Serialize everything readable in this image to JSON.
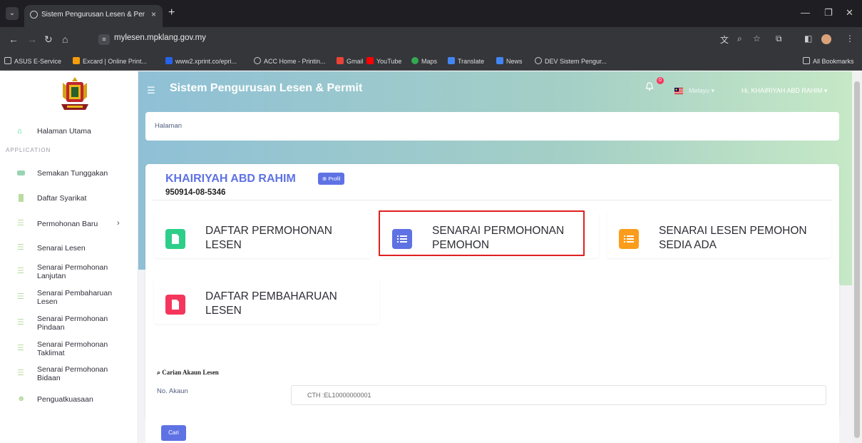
{
  "browser": {
    "tab_title": "Sistem Pengurusan Lesen & Per",
    "url": "mylesen.mpklang.gov.my",
    "bookmarks": [
      {
        "label": "ASUS E-Service",
        "color": "#9ca3af"
      },
      {
        "label": "Excard | Online Print...",
        "color": "#f59e0b"
      },
      {
        "label": "www2.xprint.co/epri...",
        "color": "#2563eb"
      },
      {
        "label": "ACC Home - Printin...",
        "color": "#9ca3af"
      },
      {
        "label": "Gmail",
        "color": "#ea4335"
      },
      {
        "label": "YouTube",
        "color": "#ff0000"
      },
      {
        "label": "Maps",
        "color": "#34a853"
      },
      {
        "label": "Translate",
        "color": "#4285f4"
      },
      {
        "label": "News",
        "color": "#4285f4"
      },
      {
        "label": "DEV Sistem Pengur...",
        "color": "#9ca3af"
      }
    ],
    "all_bookmarks": "All Bookmarks"
  },
  "header": {
    "title": "Sistem Pengurusan Lesen & Permit",
    "notification_count": "0",
    "language": "Melayu",
    "user_menu": "Hi, KHAIRIYAH ABD RAHIM"
  },
  "sidebar": {
    "home": "Halaman Utama",
    "section": "APPLICATION",
    "items": [
      {
        "label": "Semakan Tunggakan",
        "icon": "card-icon"
      },
      {
        "label": "Daftar Syarikat",
        "icon": "building-icon"
      },
      {
        "label": "Permohonan Baru",
        "icon": "list-icon"
      },
      {
        "label": "Senarai Lesen",
        "icon": "list-icon"
      },
      {
        "label": "Senarai Permohonan Lanjutan",
        "icon": "list-icon"
      },
      {
        "label": "Senarai Pembaharuan Lesen",
        "icon": "list-icon"
      },
      {
        "label": "Senarai Permohonan Pindaan",
        "icon": "list-icon"
      },
      {
        "label": "Senarai Permohonan Taklimat",
        "icon": "list-icon"
      },
      {
        "label": "Senarai Permohonan Bidaan",
        "icon": "list-icon"
      },
      {
        "label": "Penguatkuasaan",
        "icon": "people-icon"
      }
    ]
  },
  "breadcrumb": "Halaman",
  "profile": {
    "name": "KHAIRIYAH ABD RAHIM",
    "button": "Profil",
    "ic_number": "950914-08-5346"
  },
  "tiles": [
    {
      "label": "DAFTAR PERMOHONAN LESEN",
      "color": "#2dce89",
      "icon": "document-icon"
    },
    {
      "label": "SENARAI PERMOHONAN PEMOHON",
      "color": "#5e72e4",
      "icon": "list-icon"
    },
    {
      "label": "SENARAI LESEN PEMOHON SEDIA ADA",
      "color": "#fb9c1c",
      "icon": "list-icon"
    },
    {
      "label": "DAFTAR PEMBAHARUAN LESEN",
      "color": "#f5365c",
      "icon": "document-icon"
    }
  ],
  "search": {
    "title": "Carian Akaun Lesen",
    "account_label": "No. Akaun",
    "account_placeholder": "CTH :EL10000000001",
    "button": "Cari"
  }
}
